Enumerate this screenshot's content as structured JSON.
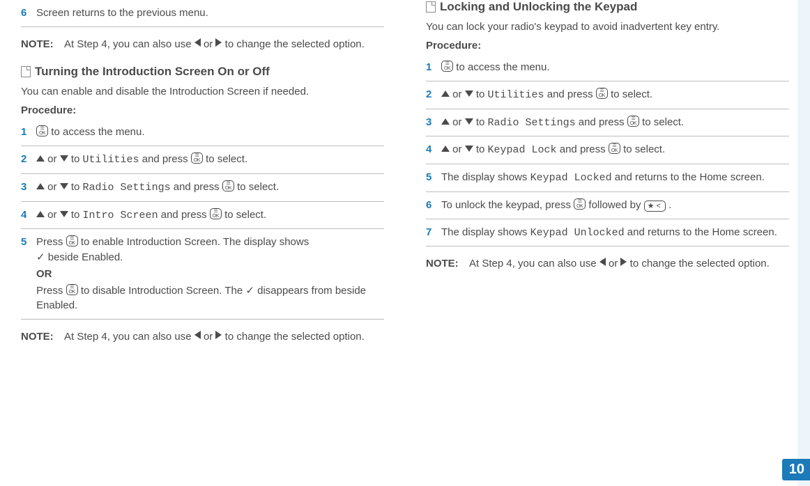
{
  "left": {
    "prev_step6_num": "6",
    "prev_step6_text": "Screen returns to the previous menu.",
    "note1_label": "NOTE:",
    "note1_text_a": "At Step 4, you can also use ",
    "note1_text_b": " or ",
    "note1_text_c": " to change the selected option.",
    "section_title": "Turning the Introduction Screen On or Off",
    "lead": "You can enable and disable the Introduction Screen if needed.",
    "procedure_label": "Procedure:",
    "s1_num": "1",
    "s1_tail": " to access the menu.",
    "s2_num": "2",
    "s2_a": " or ",
    "s2_b": " to ",
    "s2_menu": "Utilities",
    "s2_c": " and press ",
    "s2_d": " to select.",
    "s3_num": "3",
    "s3_menu": "Radio Settings",
    "s4_num": "4",
    "s4_menu": "Intro Screen",
    "s5_num": "5",
    "s5_line1a": "Press ",
    "s5_line1b": " to enable Introduction Screen. The display shows ",
    "s5_line1c": " beside Enabled.",
    "s5_or": "OR",
    "s5_line2a": "Press ",
    "s5_line2b": " to disable Introduction Screen. The ",
    "s5_line2c": " disappears from beside Enabled.",
    "note2_label": "NOTE:",
    "note2_a": "At Step 4, you can also use ",
    "note2_b": " or ",
    "note2_c": " to change the selected option."
  },
  "right": {
    "section_title": "Locking and Unlocking the Keypad",
    "lead": "You can lock your radio's keypad to avoid inadvertent key entry.",
    "procedure_label": "Procedure:",
    "s1_num": "1",
    "s1_tail": " to access the menu.",
    "s2_num": "2",
    "s2_menu": "Utilities",
    "s3_num": "3",
    "s3_menu": "Radio Settings",
    "s4_num": "4",
    "s4_menu": "Keypad Lock",
    "s5_num": "5",
    "s5_a": "The display shows ",
    "s5_menu": "Keypad Locked",
    "s5_b": " and returns to the Home screen.",
    "s6_num": "6",
    "s6_a": "To unlock the keypad, press ",
    "s6_b": " followed by ",
    "s6_c": ".",
    "s7_num": "7",
    "s7_a": "The display shows ",
    "s7_menu": "Keypad Unlocked",
    "s7_b": " and returns to the Home screen.",
    "note_label": "NOTE:",
    "note_a": "At Step 4, you can also use ",
    "note_b": " or ",
    "note_c": " to change the selected option."
  },
  "generic": {
    "or_to": " or ",
    "to_word": " to ",
    "and_press": " and press ",
    "to_select": " to select.",
    "star_label": "★ <"
  },
  "page_number": "10"
}
